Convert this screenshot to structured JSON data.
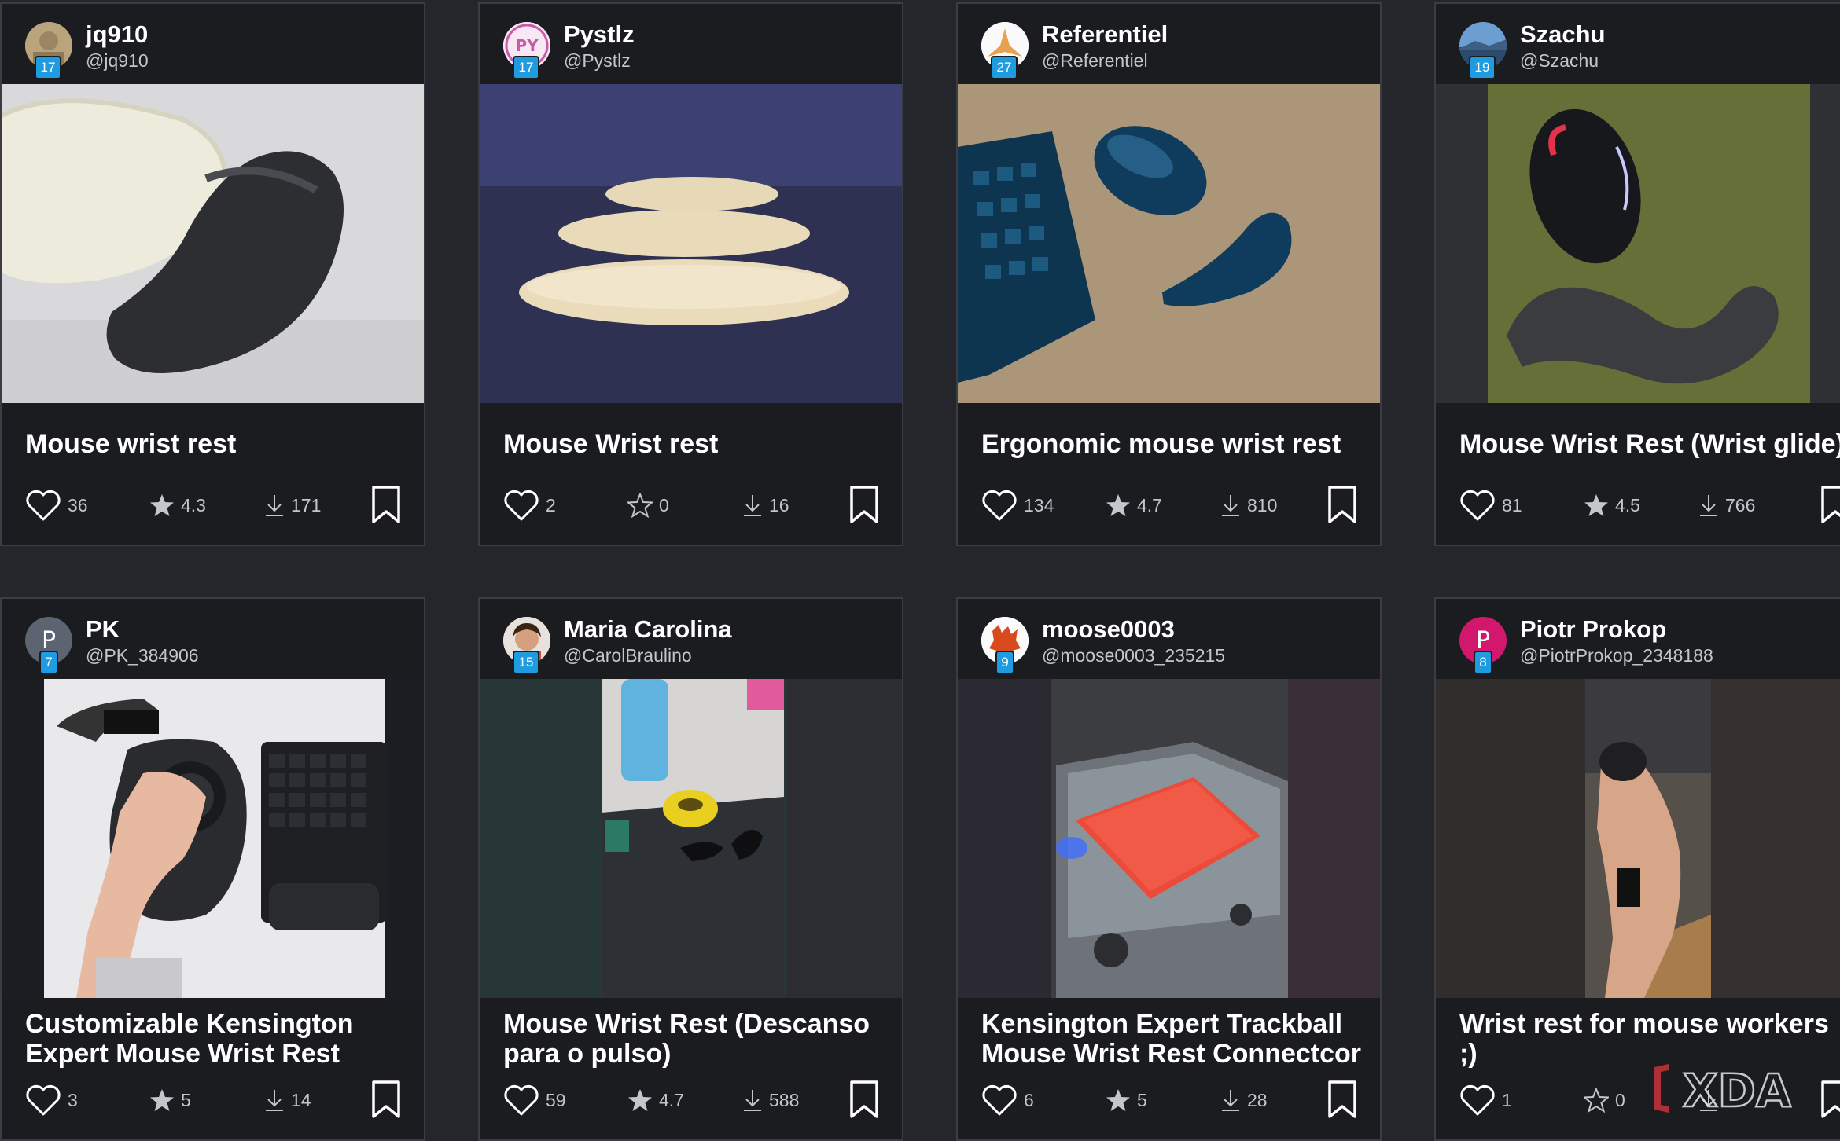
{
  "cards": [
    {
      "display_name": "jq910",
      "handle": "@jq910",
      "level": "17",
      "title": "Mouse wrist rest",
      "likes": "36",
      "rating": "4.3",
      "downloads": "171"
    },
    {
      "display_name": "Pystlz",
      "handle": "@Pystlz",
      "level": "17",
      "title": "Mouse Wrist rest",
      "likes": "2",
      "rating": "0",
      "downloads": "16"
    },
    {
      "display_name": "Referentiel",
      "handle": "@Referentiel",
      "level": "27",
      "title": "Ergonomic mouse wrist rest",
      "likes": "134",
      "rating": "4.7",
      "downloads": "810"
    },
    {
      "display_name": "Szachu",
      "handle": "@Szachu",
      "level": "19",
      "title": "Mouse Wrist Rest (Wrist glide)",
      "likes": "81",
      "rating": "4.5",
      "downloads": "766"
    },
    {
      "display_name": "PK",
      "handle": "@PK_384906",
      "level": "7",
      "avatar_letter": "P",
      "title": "Customizable Kensington Expert Mouse Wrist Rest",
      "likes": "3",
      "rating": "5",
      "downloads": "14"
    },
    {
      "display_name": "Maria Carolina",
      "handle": "@CarolBraulino",
      "level": "15",
      "title": "Mouse Wrist Rest (Descanso para o pulso)",
      "likes": "59",
      "rating": "4.7",
      "downloads": "588"
    },
    {
      "display_name": "moose0003",
      "handle": "@moose0003_235215",
      "level": "9",
      "title": "Kensington Expert Trackball Mouse Wrist Rest Connectcor",
      "likes": "6",
      "rating": "5",
      "downloads": "28"
    },
    {
      "display_name": "Piotr Prokop",
      "handle": "@PiotrProkop_2348188",
      "level": "8",
      "avatar_letter": "P",
      "title": "Wrist rest for mouse workers ;)",
      "likes": "1",
      "rating": "0",
      "downloads": ""
    }
  ],
  "avatar_text": {
    "pystlz": "PY"
  },
  "watermark": "XDA",
  "colors": {
    "background": "#25262b",
    "card": "#1b1c20",
    "border": "#3b3d44",
    "level_badge": "#1f9be0",
    "pk_avatar": "#5b6470",
    "piotr_avatar": "#d2186d"
  },
  "icons": [
    "heart-icon",
    "star-icon",
    "download-icon",
    "bookmark-icon"
  ]
}
